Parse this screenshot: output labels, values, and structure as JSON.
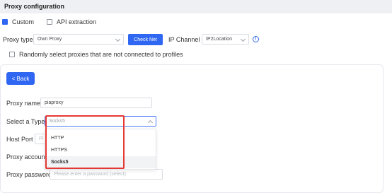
{
  "header": {
    "title": "Proxy configuration"
  },
  "mode": {
    "custom_label": "Custom",
    "api_label": "API extraction"
  },
  "proxy_type": {
    "label": "Proxy type",
    "value": "Own Proxy",
    "check_net_label": "Check Net",
    "ip_channel_label": "IP Channel",
    "ip_channel_value": "IP2Location"
  },
  "random_option": {
    "label": "Randomly select proxies that are not connected to profiles"
  },
  "form": {
    "back_label": "< Back",
    "proxy_name_label": "Proxy name",
    "proxy_name_value": "piaproxy",
    "type_label": "Select a Type",
    "type_value": "Socks5",
    "host_port_label": "Host Port",
    "host_port_placeholder": "Pl",
    "proxy_account_label": "Proxy account",
    "proxy_password_label": "Proxy password",
    "proxy_password_placeholder": "Please enter a password (select)"
  },
  "type_dropdown": {
    "options": [
      "HTTP",
      "HTTPS",
      "Socks5"
    ],
    "selected": "Socks5"
  },
  "colors": {
    "accent": "#2f67f2",
    "highlight": "#e53935"
  }
}
